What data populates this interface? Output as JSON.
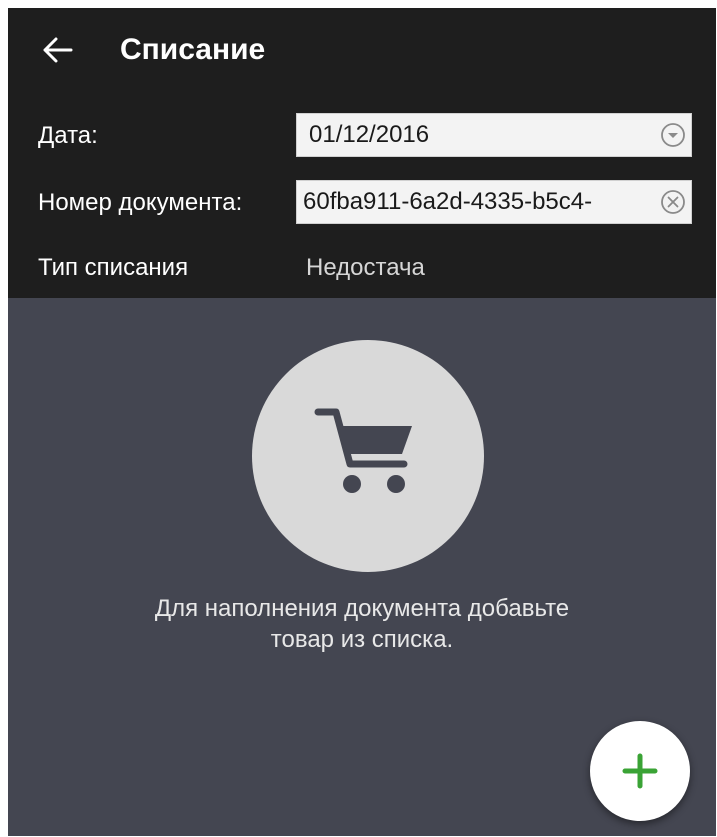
{
  "app_bar": {
    "title": "Списание",
    "back_icon": "arrow-left-icon"
  },
  "form": {
    "date": {
      "label": "Дата:",
      "value": "01/12/2016",
      "icon": "chevron-down-circle-icon"
    },
    "doc_number": {
      "label": "Номер документа:",
      "value": "60fba911-6a2d-4335-b5c4-",
      "icon": "clear-circle-icon"
    },
    "writeoff_type": {
      "label": "Тип списания",
      "value": "Недостача"
    }
  },
  "empty_state": {
    "icon": "cart-icon",
    "line1": "Для наполнения документа добавьте",
    "line2": "товар из списка."
  },
  "fab": {
    "icon": "plus-icon",
    "color": "#3aa335"
  },
  "colors": {
    "header_bg": "#1e1e1e",
    "content_bg": "#444651",
    "circle_bg": "#d9d9d9",
    "cart_color": "#444651"
  }
}
